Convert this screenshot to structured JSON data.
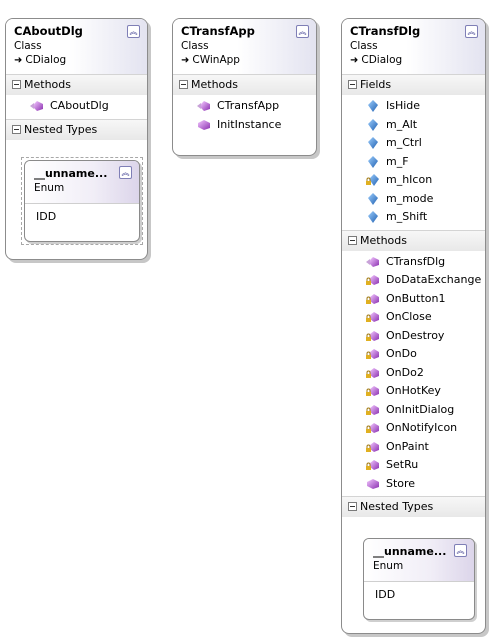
{
  "classes": {
    "about": {
      "name": "CAboutDlg",
      "kind": "Class",
      "base": "CDialog",
      "sections": {
        "methods": {
          "title": "Methods",
          "items": [
            "CAboutDlg"
          ]
        },
        "nested": {
          "title": "Nested Types",
          "enum_name": "__unname...",
          "enum_kind": "Enum",
          "enum_value": "IDD"
        }
      }
    },
    "app": {
      "name": "CTransfApp",
      "kind": "Class",
      "base": "CWinApp",
      "sections": {
        "methods": {
          "title": "Methods",
          "items": [
            "CTransfApp",
            "InitInstance"
          ]
        }
      }
    },
    "dlg": {
      "name": "CTransfDlg",
      "kind": "Class",
      "base": "CDialog",
      "sections": {
        "fields": {
          "title": "Fields",
          "items": [
            "IsHide",
            "m_Alt",
            "m_Ctrl",
            "m_F",
            "m_hIcon",
            "m_mode",
            "m_Shift"
          ]
        },
        "methods": {
          "title": "Methods",
          "items": [
            "CTransfDlg",
            "DoDataExchange",
            "OnButton1",
            "OnClose",
            "OnDestroy",
            "OnDo",
            "OnDo2",
            "OnHotKey",
            "OnInitDialog",
            "OnNotifyIcon",
            "OnPaint",
            "SetRu",
            "Store"
          ]
        },
        "nested": {
          "title": "Nested Types",
          "enum_name": "__unname...",
          "enum_kind": "Enum",
          "enum_value": "IDD"
        }
      }
    }
  },
  "icons": {
    "collapse": "double-chevron-up-icon",
    "inherit": "inheritance-arrow-icon",
    "field": "field-icon",
    "protected_field": "protected-field-icon",
    "method": "method-icon",
    "protected_method": "protected-method-icon"
  },
  "colors": {
    "field": "#3a78c8",
    "method": "#9b59b6",
    "protected_lock": "#d4a017",
    "border": "#8c8c8c"
  }
}
